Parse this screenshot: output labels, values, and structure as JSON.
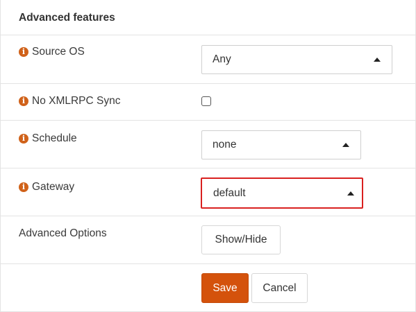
{
  "panel": {
    "title": "Advanced features"
  },
  "rows": {
    "source_os": {
      "label": "Source OS",
      "value": "Any",
      "icon": "info-icon"
    },
    "no_xmlrpc_sync": {
      "label": "No XMLRPC Sync",
      "checked": false,
      "icon": "info-icon"
    },
    "schedule": {
      "label": "Schedule",
      "value": "none",
      "icon": "info-icon"
    },
    "gateway": {
      "label": "Gateway",
      "value": "default",
      "icon": "info-icon",
      "highlight_color": "#d9201f"
    },
    "advanced_options": {
      "label": "Advanced Options",
      "button_label": "Show/Hide"
    }
  },
  "actions": {
    "save_label": "Save",
    "cancel_label": "Cancel"
  },
  "colors": {
    "accent": "#d4520c",
    "info_icon": "#d0621a",
    "border": "#e3e3e3"
  }
}
